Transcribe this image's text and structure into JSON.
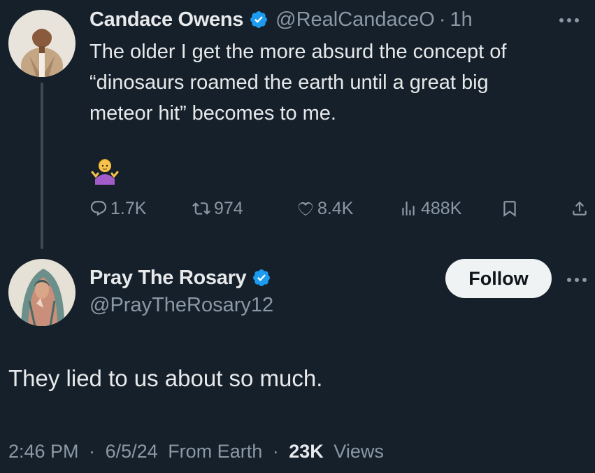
{
  "colors": {
    "background": "#15202b",
    "text_primary": "#e7e9ea",
    "text_secondary": "#8b98a5",
    "verified_blue": "#1d9bf0",
    "follow_button_bg": "#eff3f4"
  },
  "original_tweet": {
    "author": {
      "display_name": "Candace Owens",
      "handle": "@RealCandaceO",
      "verified": true,
      "avatar_icon": "profile-photo-woman-in-beige-blazer"
    },
    "separator": "·",
    "time_ago": "1h",
    "text_lines": [
      "The older I get the more absurd the concept of",
      "“dinosaurs roamed the earth until a great big",
      "meteor hit” becomes to me."
    ],
    "emoji_icon": "person-shrugging-emoji",
    "metrics": {
      "replies": "1.7K",
      "reposts": "974",
      "likes": "8.4K",
      "views": "488K"
    },
    "action_icons": [
      "reply-icon",
      "repost-icon",
      "like-icon",
      "views-icon",
      "bookmark-icon",
      "share-icon"
    ]
  },
  "reply": {
    "author": {
      "display_name": "Pray The Rosary",
      "handle": "@PrayTheRosary12",
      "verified": true,
      "avatar_icon": "profile-photo-virgin-mary-praying"
    },
    "follow_label": "Follow",
    "text": "They lied to us about so much.",
    "meta": {
      "time": "2:46 PM",
      "separator": "·",
      "date": "6/5/24",
      "source": "From Earth",
      "views_count": "23K",
      "views_label": "Views"
    }
  }
}
